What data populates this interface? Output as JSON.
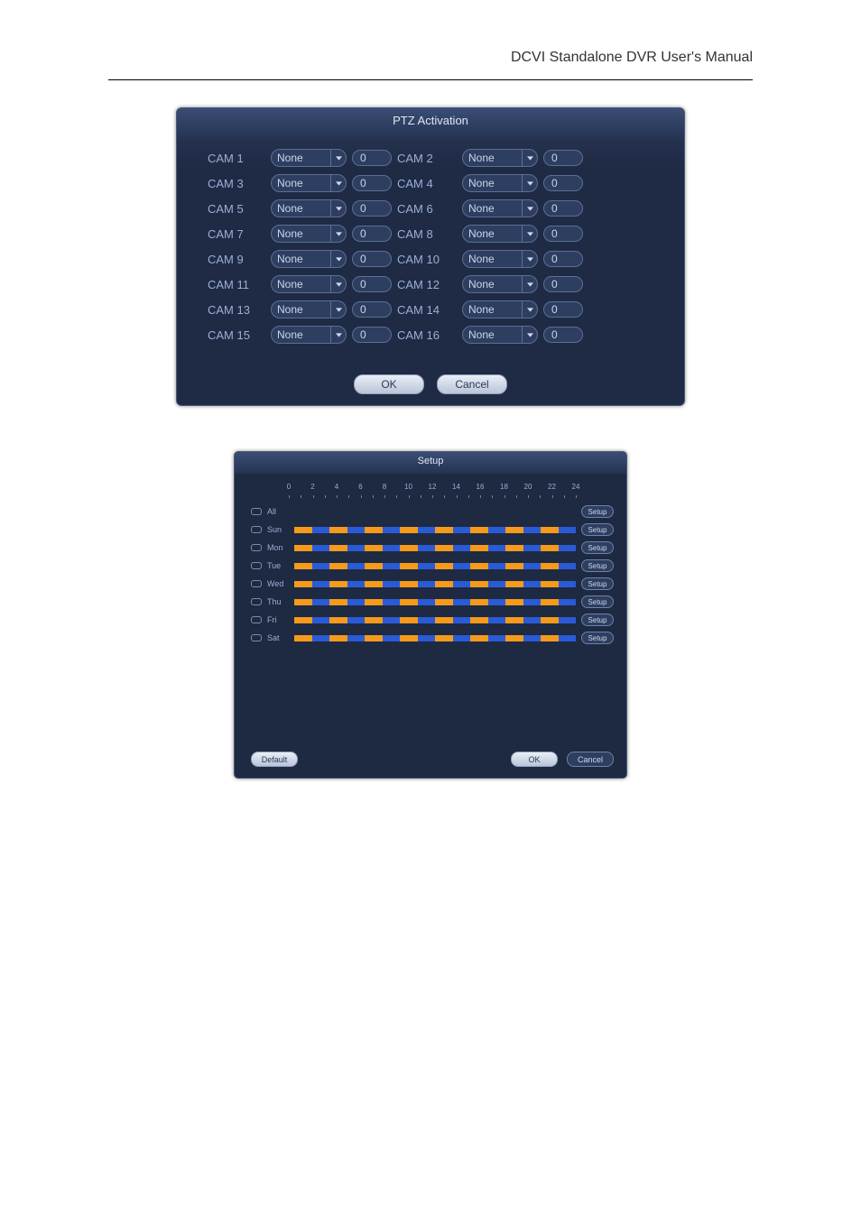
{
  "header": {
    "manual_title": "DCVI Standalone DVR User's Manual"
  },
  "ptz": {
    "title": "PTZ Activation",
    "cams": [
      {
        "label": "CAM 1",
        "select": "None",
        "value": "0"
      },
      {
        "label": "CAM 2",
        "select": "None",
        "value": "0"
      },
      {
        "label": "CAM 3",
        "select": "None",
        "value": "0"
      },
      {
        "label": "CAM 4",
        "select": "None",
        "value": "0"
      },
      {
        "label": "CAM 5",
        "select": "None",
        "value": "0"
      },
      {
        "label": "CAM 6",
        "select": "None",
        "value": "0"
      },
      {
        "label": "CAM 7",
        "select": "None",
        "value": "0"
      },
      {
        "label": "CAM 8",
        "select": "None",
        "value": "0"
      },
      {
        "label": "CAM 9",
        "select": "None",
        "value": "0"
      },
      {
        "label": "CAM 10",
        "select": "None",
        "value": "0"
      },
      {
        "label": "CAM 11",
        "select": "None",
        "value": "0"
      },
      {
        "label": "CAM 12",
        "select": "None",
        "value": "0"
      },
      {
        "label": "CAM 13",
        "select": "None",
        "value": "0"
      },
      {
        "label": "CAM 14",
        "select": "None",
        "value": "0"
      },
      {
        "label": "CAM 15",
        "select": "None",
        "value": "0"
      },
      {
        "label": "CAM 16",
        "select": "None",
        "value": "0"
      }
    ],
    "ok_label": "OK",
    "cancel_label": "Cancel"
  },
  "setup": {
    "title": "Setup",
    "hours": [
      "0",
      "2",
      "4",
      "6",
      "8",
      "10",
      "12",
      "14",
      "16",
      "18",
      "20",
      "22",
      "24"
    ],
    "days": [
      {
        "id": "all",
        "label": "All",
        "setup": "Setup"
      },
      {
        "id": "sun",
        "label": "Sun",
        "setup": "Setup"
      },
      {
        "id": "mon",
        "label": "Mon",
        "setup": "Setup"
      },
      {
        "id": "tue",
        "label": "Tue",
        "setup": "Setup"
      },
      {
        "id": "wed",
        "label": "Wed",
        "setup": "Setup"
      },
      {
        "id": "thu",
        "label": "Thu",
        "setup": "Setup"
      },
      {
        "id": "fri",
        "label": "Fri",
        "setup": "Setup"
      },
      {
        "id": "sat",
        "label": "Sat",
        "setup": "Setup"
      }
    ],
    "default_label": "Default",
    "ok_label": "OK",
    "cancel_label": "Cancel"
  }
}
